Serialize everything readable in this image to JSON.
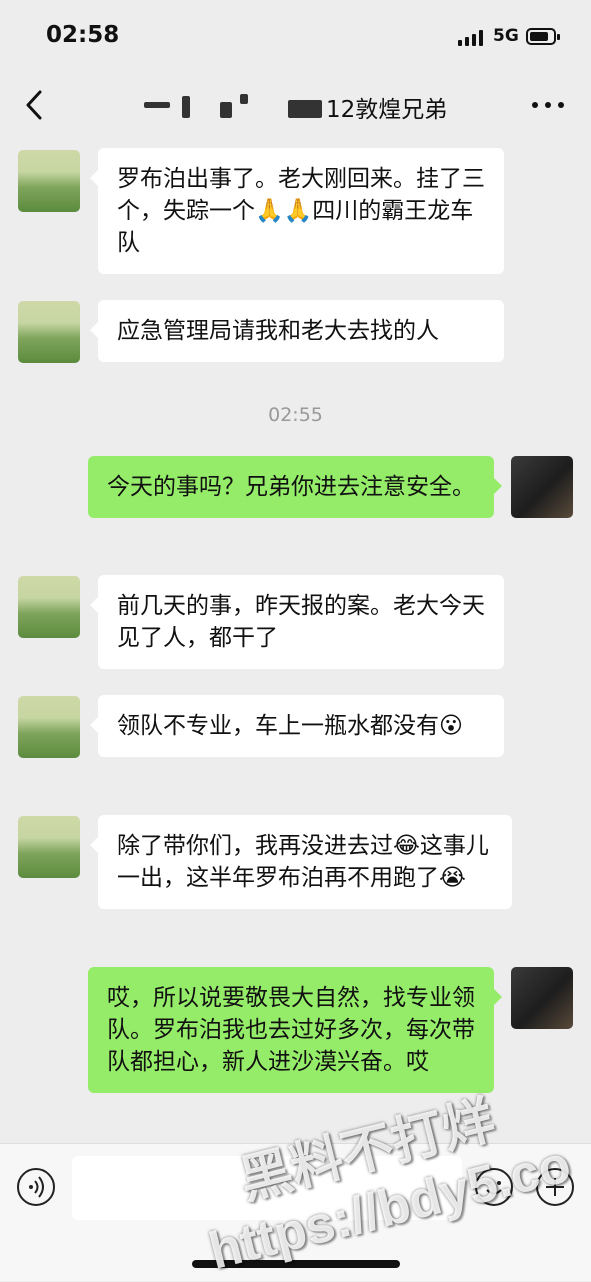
{
  "status_bar": {
    "time": "02:58",
    "network": "5G"
  },
  "nav": {
    "title": "12敦煌兄弟"
  },
  "messages": {
    "m1": {
      "text": "罗布泊出事了。老大刚回来。挂了三个，失踪一个🙏🙏四川的霸王龙车队"
    },
    "m2": {
      "text": "应急管理局请我和老大去找的人"
    },
    "timestamp": "02:55",
    "m3": {
      "text": "今天的事吗？兄弟你进去注意安全。"
    },
    "m4": {
      "text": "前几天的事，昨天报的案。老大今天见了人，都干了"
    },
    "m5": {
      "text": "领队不专业，车上一瓶水都没有😮"
    },
    "m6": {
      "text": "除了带你们，我再没进去过😂这事儿一出，这半年罗布泊再不用跑了😭"
    },
    "m7": {
      "text": "哎，所以说要敬畏大自然，找专业领队。罗布泊我也去过好多次，每次带队都担心，新人进沙漠兴奋。哎"
    }
  },
  "watermark": {
    "line1": "黑料不打烊",
    "line2": "https://bdy5.co"
  },
  "icons": [
    "back-icon",
    "more-icon",
    "voice-icon",
    "emoji-icon",
    "plus-icon"
  ]
}
